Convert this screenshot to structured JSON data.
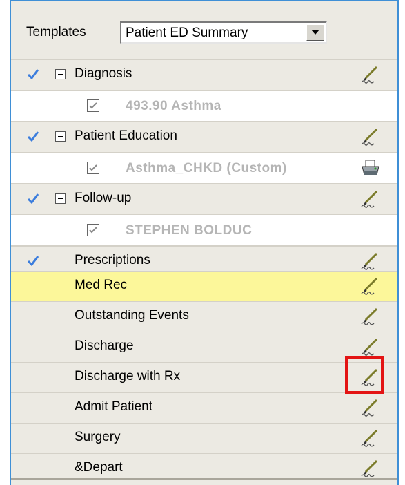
{
  "templates": {
    "label": "Templates",
    "selected": "Patient ED Summary"
  },
  "sections": [
    {
      "label": "Diagnosis",
      "checked": true,
      "expandable": true,
      "sub": "493.90 Asthma"
    },
    {
      "label": "Patient Education",
      "checked": true,
      "expandable": true,
      "sub": "Asthma_CHKD (Custom)",
      "sub_icon": "printer-icon"
    },
    {
      "label": "Follow-up",
      "checked": true,
      "expandable": true,
      "sub": "STEPHEN BOLDUC"
    },
    {
      "label": "Prescriptions",
      "checked": true
    },
    {
      "label": "Med Rec",
      "highlighted": true
    },
    {
      "label": "Outstanding Events"
    },
    {
      "label": "Discharge"
    },
    {
      "label": "Discharge with Rx",
      "highlight_box": true
    },
    {
      "label": "Admit Patient"
    },
    {
      "label": "Surgery"
    },
    {
      "label": "&Depart"
    }
  ],
  "colors": {
    "highlight": "#fcf79a",
    "check": "#3b7ddd",
    "annotation": "#e31414"
  }
}
